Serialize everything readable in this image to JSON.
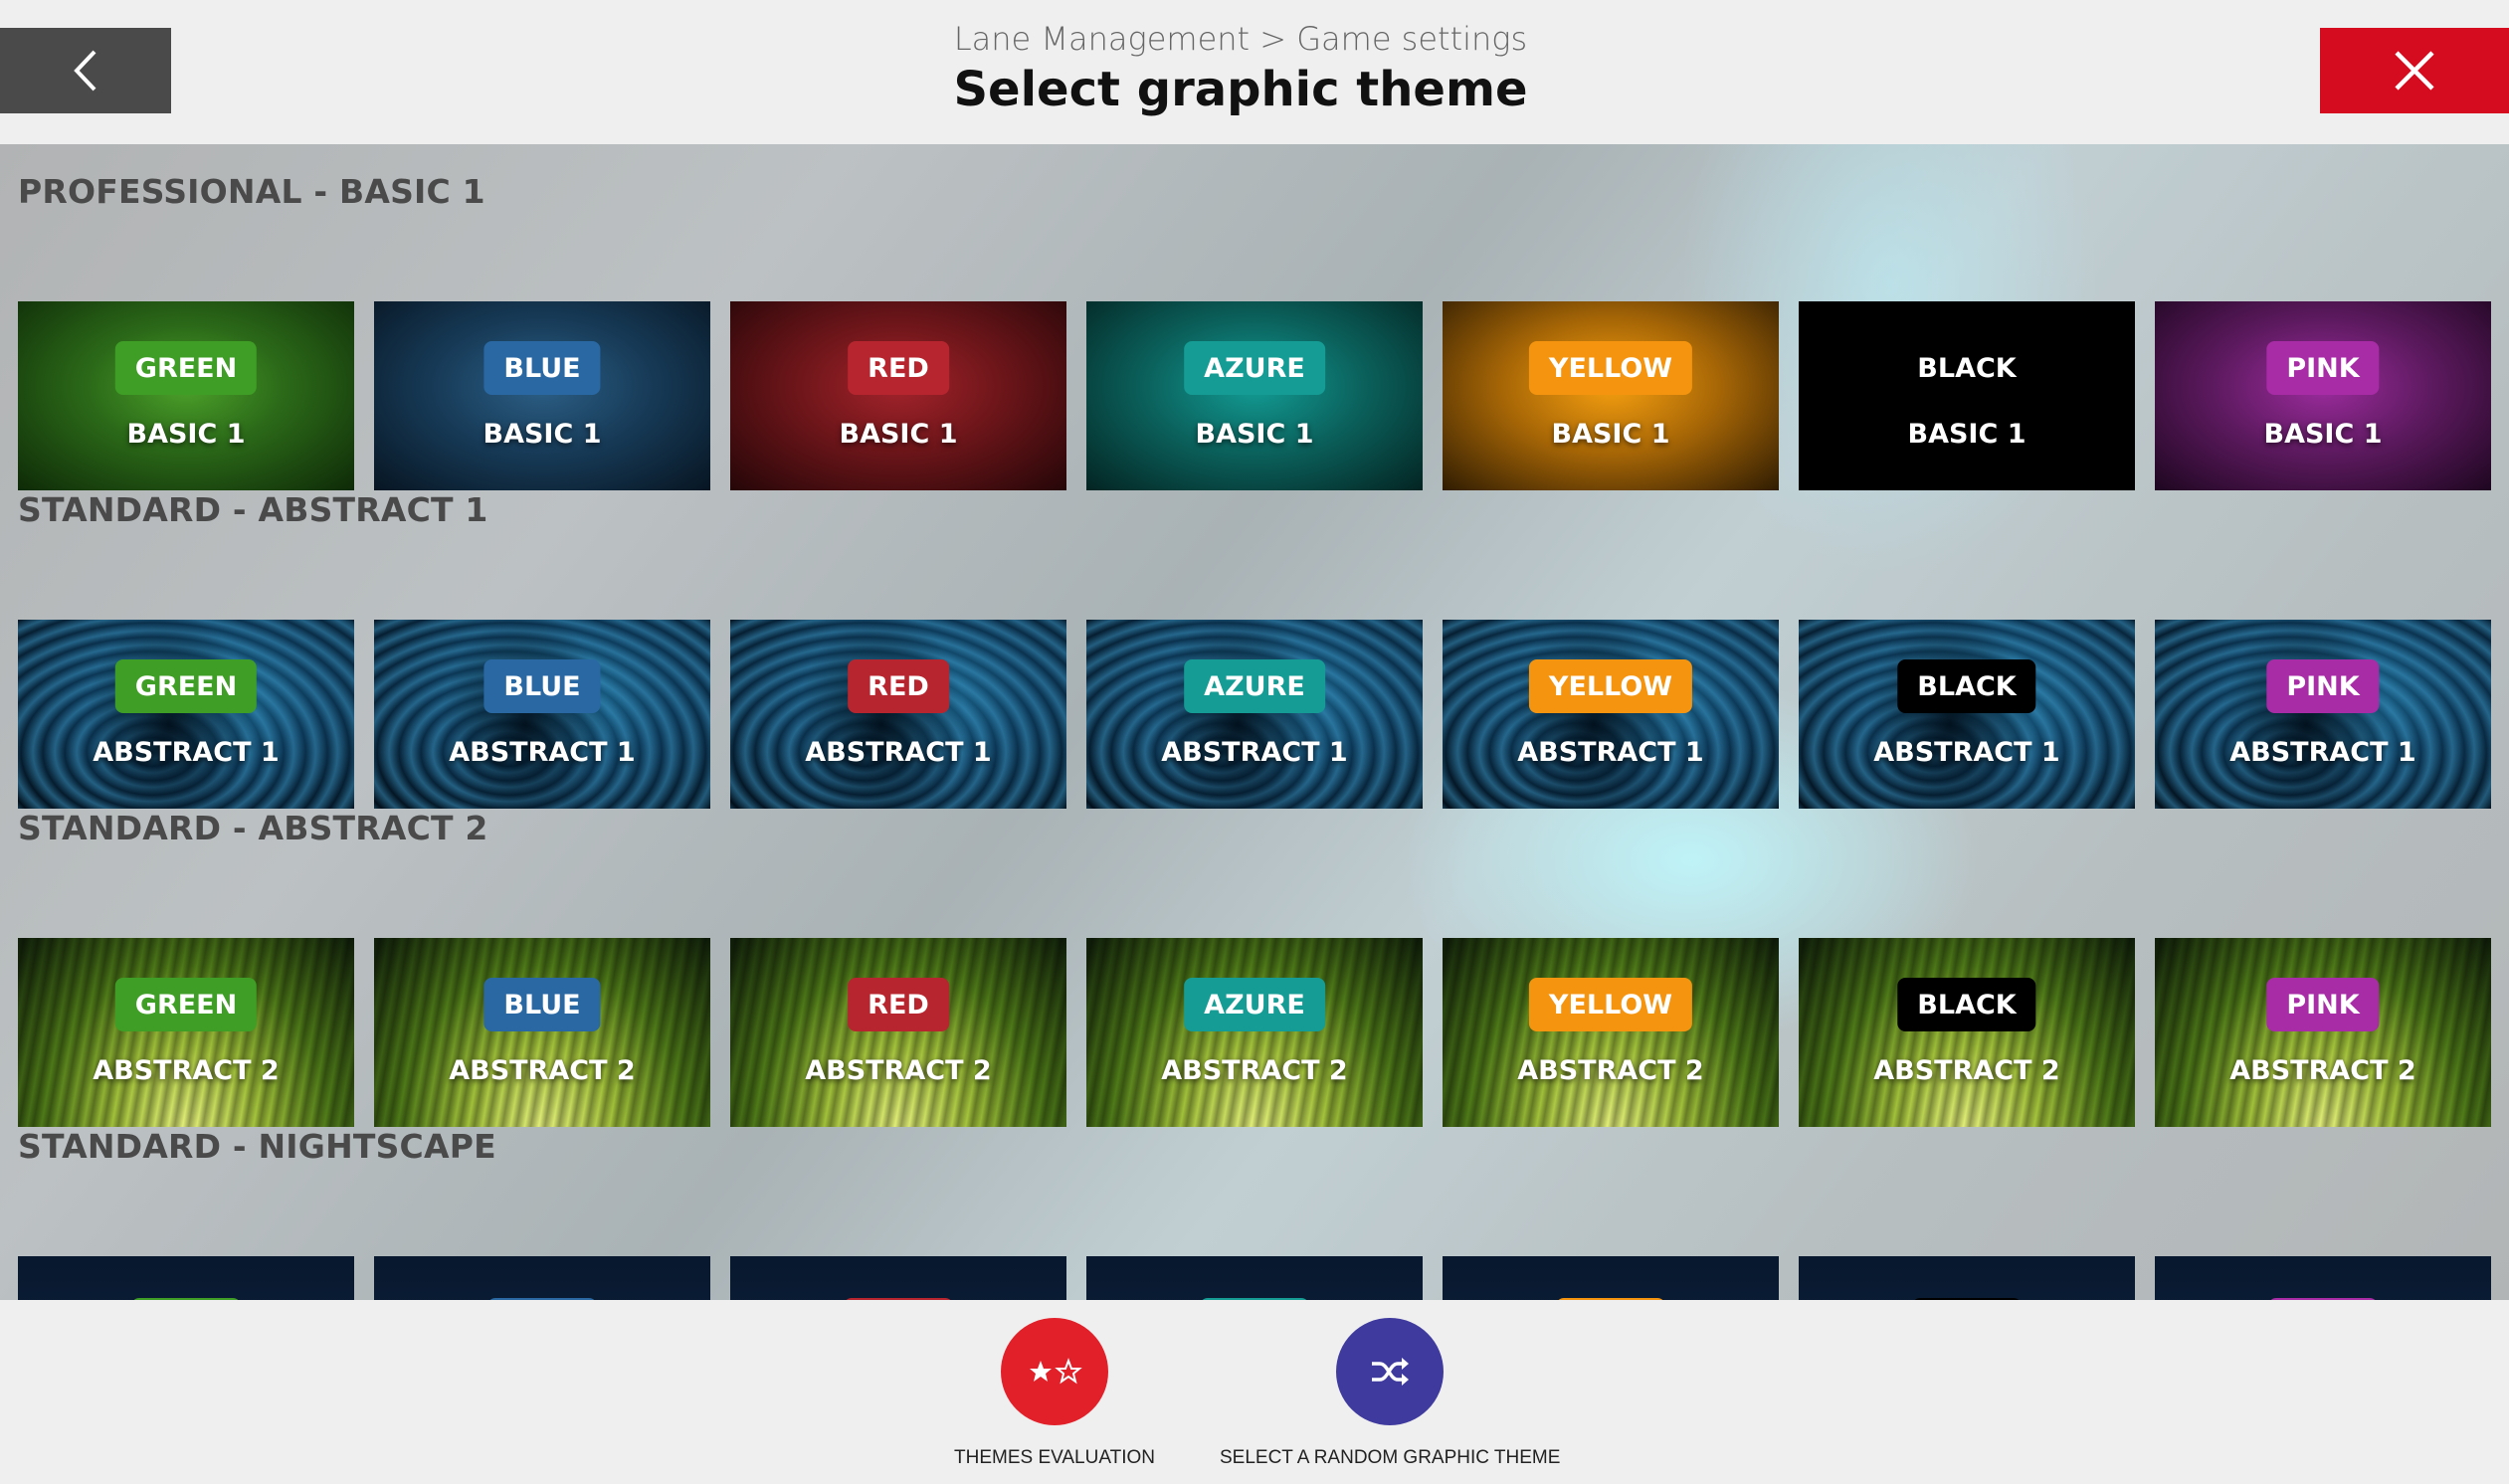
{
  "header": {
    "breadcrumb": "Lane Management > Game settings",
    "title": "Select graphic theme",
    "back_icon": "chevron-left-icon",
    "close_icon": "close-icon"
  },
  "sections": [
    {
      "title": "PROFESSIONAL - BASIC 1",
      "tiles": [
        {
          "badge": "GREEN",
          "name": "BASIC 1"
        },
        {
          "badge": "BLUE",
          "name": "BASIC 1"
        },
        {
          "badge": "RED",
          "name": "BASIC 1"
        },
        {
          "badge": "AZURE",
          "name": "BASIC 1"
        },
        {
          "badge": "YELLOW",
          "name": "BASIC 1"
        },
        {
          "badge": "BLACK",
          "name": "BASIC 1"
        },
        {
          "badge": "PINK",
          "name": "BASIC 1"
        }
      ]
    },
    {
      "title": "STANDARD - ABSTRACT 1",
      "tiles": [
        {
          "badge": "GREEN",
          "name": "ABSTRACT 1"
        },
        {
          "badge": "BLUE",
          "name": "ABSTRACT 1"
        },
        {
          "badge": "RED",
          "name": "ABSTRACT 1"
        },
        {
          "badge": "AZURE",
          "name": "ABSTRACT 1"
        },
        {
          "badge": "YELLOW",
          "name": "ABSTRACT 1"
        },
        {
          "badge": "BLACK",
          "name": "ABSTRACT 1"
        },
        {
          "badge": "PINK",
          "name": "ABSTRACT 1"
        }
      ]
    },
    {
      "title": "STANDARD - ABSTRACT 2",
      "tiles": [
        {
          "badge": "GREEN",
          "name": "ABSTRACT 2"
        },
        {
          "badge": "BLUE",
          "name": "ABSTRACT 2"
        },
        {
          "badge": "RED",
          "name": "ABSTRACT 2"
        },
        {
          "badge": "AZURE",
          "name": "ABSTRACT 2"
        },
        {
          "badge": "YELLOW",
          "name": "ABSTRACT 2"
        },
        {
          "badge": "BLACK",
          "name": "ABSTRACT 2"
        },
        {
          "badge": "PINK",
          "name": "ABSTRACT 2"
        }
      ]
    },
    {
      "title": "STANDARD - NIGHTSCAPE",
      "tiles": [
        {
          "badge": "",
          "name": ""
        },
        {
          "badge": "",
          "name": ""
        },
        {
          "badge": "",
          "name": ""
        },
        {
          "badge": "",
          "name": ""
        },
        {
          "badge": "",
          "name": ""
        },
        {
          "badge": "",
          "name": ""
        },
        {
          "badge": "",
          "name": ""
        }
      ]
    }
  ],
  "footer": {
    "evaluation_label": "THEMES EVALUATION",
    "evaluation_icon": "stars-icon",
    "random_label": "SELECT A RANDOM GRAPHIC THEME",
    "random_icon": "shuffle-icon"
  },
  "colors": {
    "close": "#d50b1f",
    "back": "#4a4a4a",
    "evaluation": "#e2202a",
    "random": "#3f3a9e",
    "green": "#3f9e25",
    "blue": "#2a68a3",
    "red": "#b7262f",
    "azure": "#159c95",
    "yellow": "#f5940e",
    "black": "#000000",
    "pink": "#a72ca5"
  }
}
